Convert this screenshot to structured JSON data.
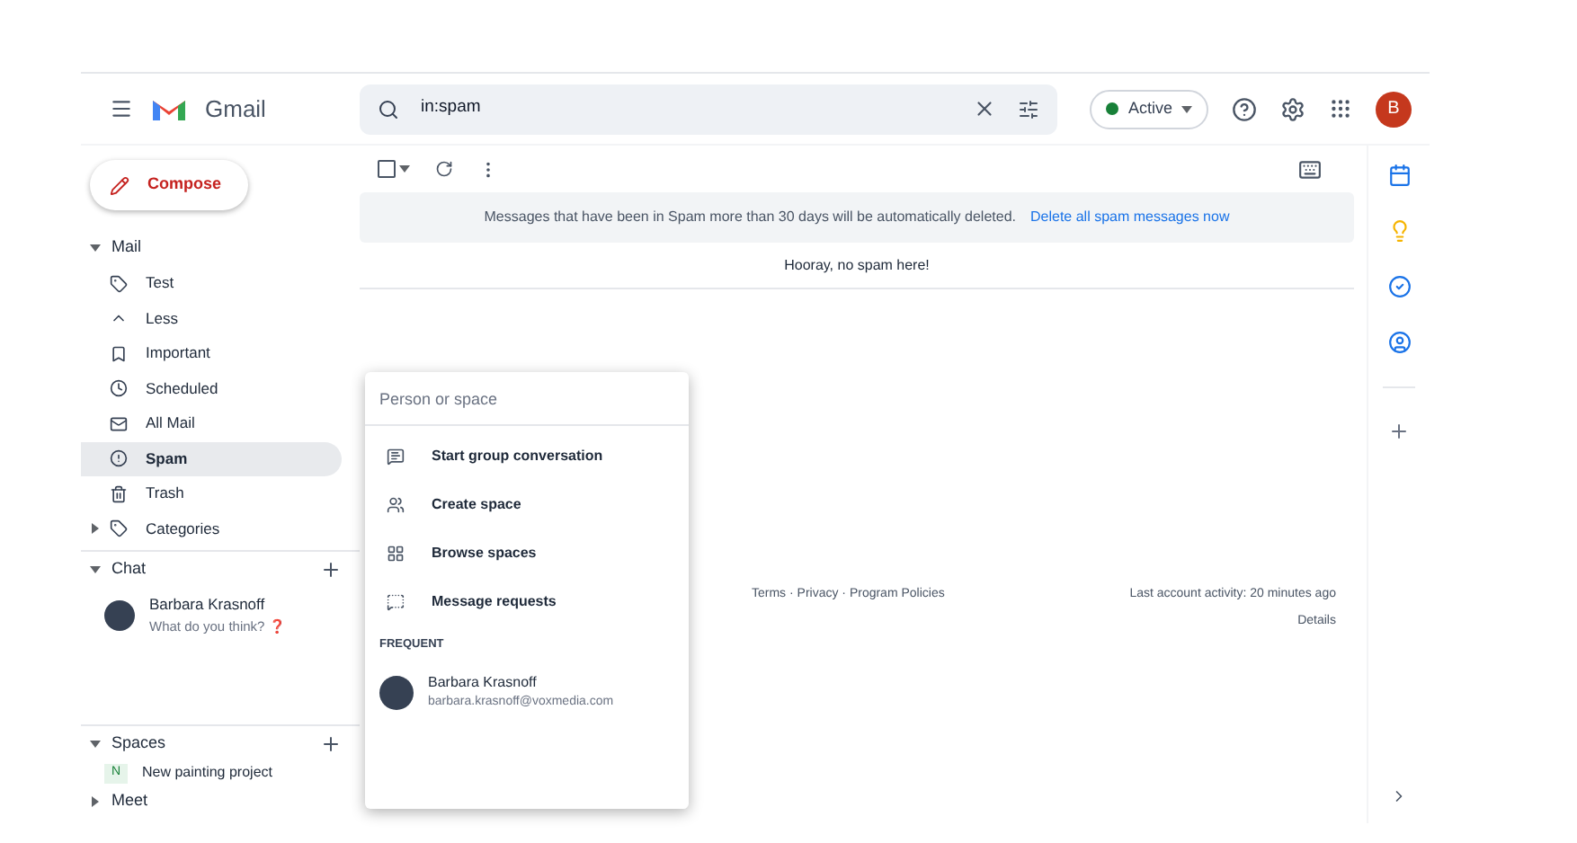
{
  "header": {
    "app_name": "Gmail",
    "search": {
      "value": "in:spam"
    },
    "status": {
      "label": "Active",
      "color": "#188038"
    },
    "avatar_letter": "B"
  },
  "compose": "Compose",
  "mail": {
    "label": "Mail",
    "expanded": true,
    "items": [
      {
        "label": "Test",
        "kind": "label",
        "selected": false
      },
      {
        "label": "Less",
        "kind": "less",
        "selected": false
      },
      {
        "label": "Important",
        "kind": "important",
        "selected": false
      },
      {
        "label": "Scheduled",
        "kind": "scheduled",
        "selected": false
      },
      {
        "label": "All Mail",
        "kind": "all",
        "selected": false
      },
      {
        "label": "Spam",
        "kind": "spam",
        "selected": true
      },
      {
        "label": "Trash",
        "kind": "trash",
        "selected": false
      },
      {
        "label": "Categories",
        "kind": "label",
        "selected": false,
        "expanded": false
      }
    ]
  },
  "toolbar": {
    "select_all": {
      "checked": false
    }
  },
  "chat": {
    "label": "Chat",
    "expanded": true,
    "contacts": [
      {
        "name": "Barbara Krasnoff",
        "message": "What do you think? ❓"
      }
    ]
  },
  "spaces": {
    "label": "Spaces",
    "expanded": true,
    "items": [
      {
        "initial": "N",
        "name": "New painting project"
      }
    ]
  },
  "meet": {
    "label": "Meet",
    "expanded": false
  },
  "banner": {
    "text": "Messages that have been in Spam more than 30 days will be automatically deleted.",
    "link": "Delete all spam messages now"
  },
  "empty_message": "Hooray, no spam here!",
  "footer": {
    "links": "Terms · Privacy · Program Policies",
    "activity": "Last account activity: 20 minutes ago",
    "details": "Details"
  },
  "popup": {
    "placeholder": "Person or space",
    "actions": [
      {
        "label": "Start group conversation",
        "kind": "conversation"
      },
      {
        "label": "Create space",
        "kind": "create"
      },
      {
        "label": "Browse spaces",
        "kind": "browse"
      },
      {
        "label": "Message requests",
        "kind": "requests"
      }
    ],
    "section_label": "FREQUENT",
    "contacts": [
      {
        "name": "Barbara Krasnoff",
        "email": "barbara.krasnoff@voxmedia.com"
      }
    ]
  }
}
